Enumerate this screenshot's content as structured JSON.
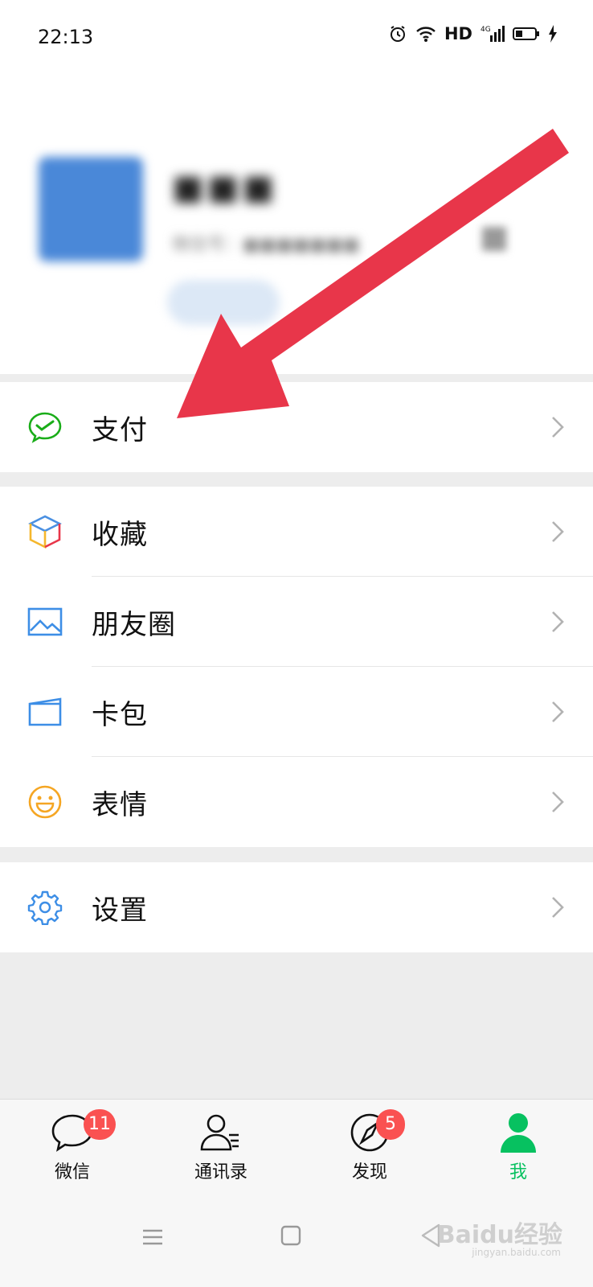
{
  "status_bar": {
    "time": "22:13",
    "hd": "HD",
    "network": "4G",
    "icons": [
      "alarm-icon",
      "wifi-icon",
      "signal-icon",
      "battery-icon",
      "charging-icon"
    ]
  },
  "profile": {
    "nickname": "■■■",
    "wechat_id": "微信号：■■■■■■■",
    "status_button": "■ ■■"
  },
  "menu": {
    "pay": {
      "label": "支付",
      "icon": "wechat-pay-icon"
    },
    "favorites": {
      "label": "收藏",
      "icon": "favorites-cube-icon"
    },
    "moments": {
      "label": "朋友圈",
      "icon": "moments-image-icon"
    },
    "cards": {
      "label": "卡包",
      "icon": "card-wallet-icon"
    },
    "stickers": {
      "label": "表情",
      "icon": "smiley-icon"
    },
    "settings": {
      "label": "设置",
      "icon": "gear-icon"
    }
  },
  "tabs": [
    {
      "label": "微信",
      "icon": "chat-bubble-icon",
      "badge": "11"
    },
    {
      "label": "通讯录",
      "icon": "contacts-icon",
      "badge": ""
    },
    {
      "label": "发现",
      "icon": "compass-icon",
      "badge": "5"
    },
    {
      "label": "我",
      "icon": "person-icon",
      "badge": "",
      "active": true
    }
  ],
  "watermark": {
    "text": "Baidu经验",
    "sub": "jingyan.baidu.com"
  },
  "colors": {
    "accent_green": "#07c160",
    "badge_red": "#fa5151",
    "arrow_red": "#e8364a",
    "background": "#ededed"
  }
}
